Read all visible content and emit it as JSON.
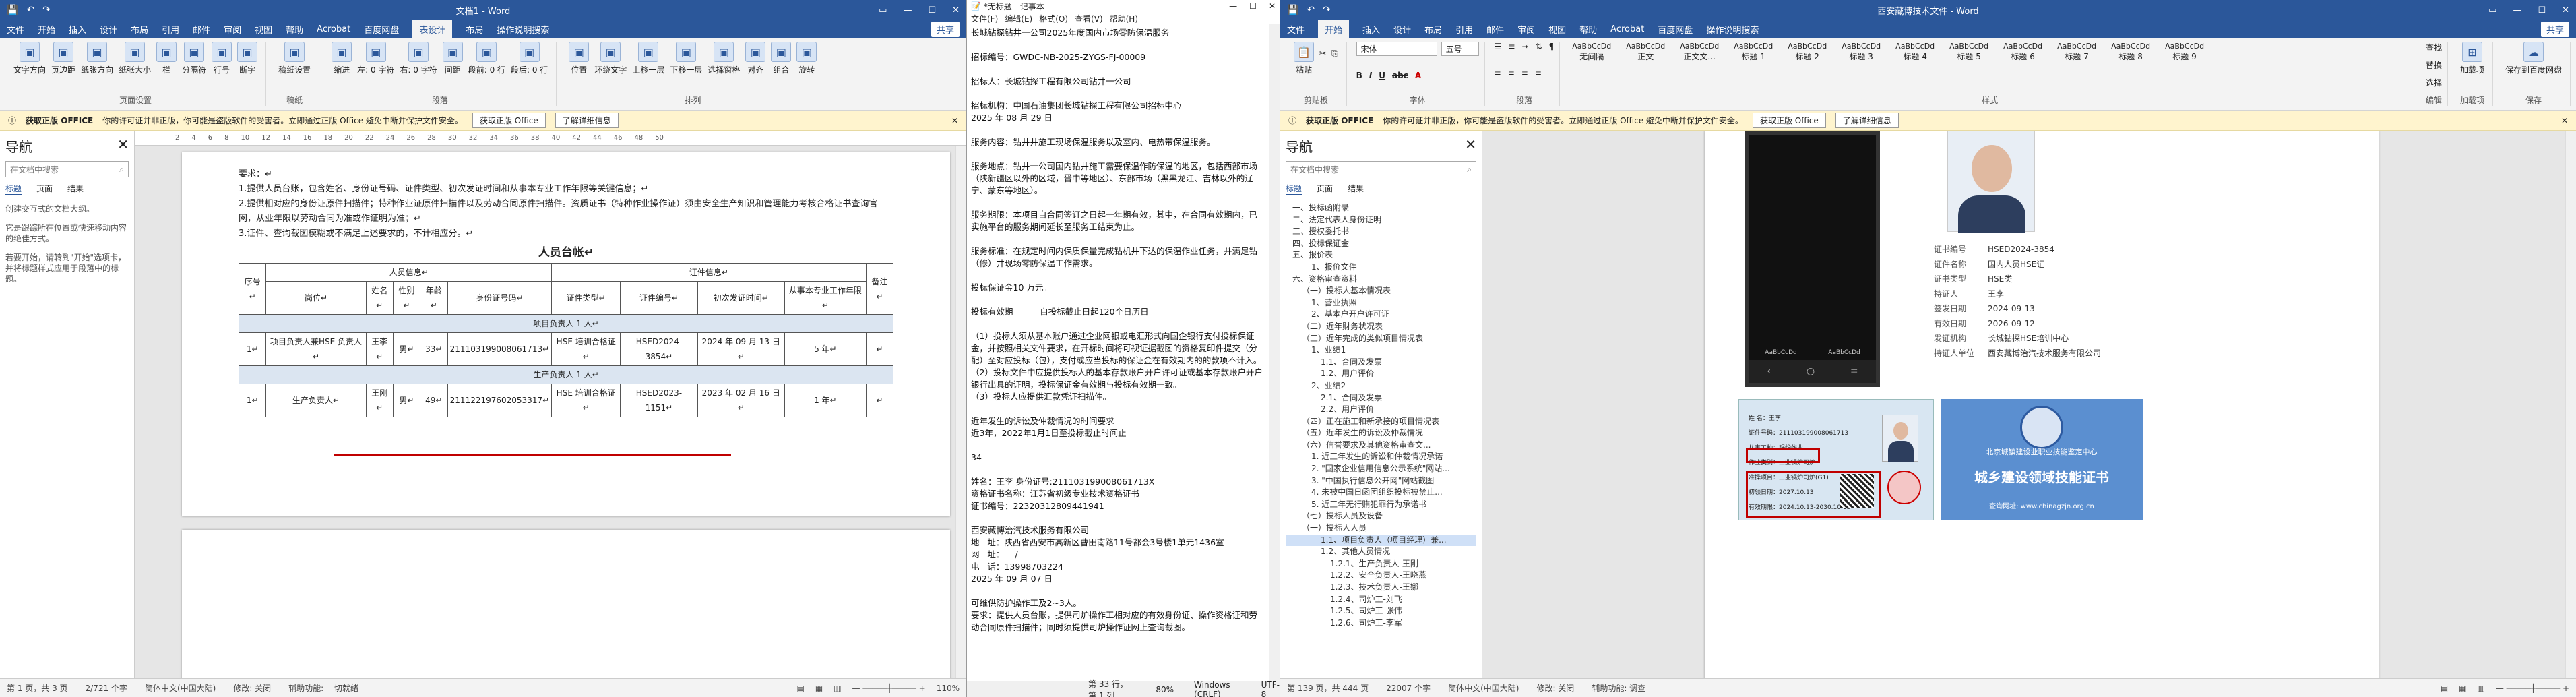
{
  "w1": {
    "title": "文档1 - Word",
    "context_tab": "表格工具",
    "tabs": [
      "文件",
      "开始",
      "插入",
      "设计",
      "布局",
      "引用",
      "邮件",
      "审阅",
      "视图",
      "帮助",
      "Acrobat",
      "百度网盘",
      "表设计",
      "布局"
    ],
    "active_tab": "布局",
    "search_hint": "操作说明搜索",
    "share": "共享",
    "ribbon": {
      "groups": [
        {
          "label": "页面设置",
          "buttons": [
            "文字方向",
            "页边距",
            "纸张方向",
            "纸张大小",
            "栏",
            "分隔符",
            "行号",
            "断字"
          ]
        },
        {
          "label": "稿纸",
          "buttons": [
            "稿纸设置"
          ]
        },
        {
          "label": "段落",
          "buttons": [
            "缩进",
            "左: 0 字符",
            "右: 0 字符",
            "间距",
            "段前: 0 行",
            "段后: 0 行"
          ]
        },
        {
          "label": "排列",
          "buttons": [
            "位置",
            "环绕文字",
            "上移一层",
            "下移一层",
            "选择窗格",
            "对齐",
            "组合",
            "旋转"
          ]
        }
      ]
    },
    "msg": {
      "label": "获取正版 OFFICE",
      "text": "你的许可证并非正版，你可能是盗版软件的受害者。立即通过正版 Office 避免中断并保护文件安全。",
      "btn1": "获取正版 Office",
      "btn2": "了解详细信息"
    },
    "nav": {
      "title": "导航",
      "search": "在文档中搜索",
      "tabs": [
        "标题",
        "页面",
        "结果"
      ],
      "p1": "创建交互式的文档大纲。",
      "p2": "它是跟踪所在位置或快速移动内容的绝佳方式。",
      "p3": "若要开始，请转到\"开始\"选项卡，并将标题样式应用于段落中的标题。"
    },
    "doc": {
      "line0": "要求：↵",
      "line1": "1.提供人员台账，包含姓名、身份证号码、证件类型、初次发证时间和从事本专业工作年限等关键信息；↵",
      "line2": "2.提供相对应的身份证原件扫描件；特种作业证原件扫描件以及劳动合同原件扫描件。资质证书（特种作业操作证）须由安全生产知识和管理能力考核合格证书查询官网，从业年限以劳动合同为准或作证明为准；↵",
      "line3": "3.证件、查询截图模糊或不满足上述要求的，不计相应分。↵",
      "table_title": "人员台帐↵",
      "headers": {
        "seq": "序号↵",
        "personnel": "人员信息↵",
        "cert": "证件信息↵",
        "remark": "备注↵",
        "post": "岗位↵",
        "name": "姓名↵",
        "gender": "性别↵",
        "age": "年龄↵",
        "idno": "身份证号码↵",
        "ctype": "证件类型↵",
        "cno": "证件编号↵",
        "first": "初次发证时间↵",
        "years": "从事本专业工作年限↵"
      },
      "section1": "项目负责人 1 人↵",
      "row1": [
        "1↵",
        "项目负责人兼HSE 负责人↵",
        "王李↵",
        "男↵",
        "33↵",
        "211103199008061713↵",
        "HSE 培训合格证↵",
        "HSED2024-3854↵",
        "2024 年 09 月 13 日↵",
        "5 年↵",
        "↵"
      ],
      "section2": "生产负责人 1 人↵",
      "row2": [
        "1↵",
        "生产负责人↵",
        "王刚↵",
        "男↵",
        "49↵",
        "211122197602053317↵",
        "HSE 培训合格证↵",
        "HSED2023-1151↵",
        "2023 年 02 月 16 日↵",
        "1 年↵",
        "↵"
      ]
    },
    "status": {
      "page": "第 1 页，共 3 页",
      "words": "2/721 个字",
      "lang": "简体中文(中国大陆)",
      "mode": "修改: 关闭",
      "access": "辅助功能: 一切就绪",
      "zoom": "110%"
    }
  },
  "w2": {
    "title": "*无标题 - 记事本",
    "menu": [
      "文件(F)",
      "编辑(E)",
      "格式(O)",
      "查看(V)",
      "帮助(H)"
    ],
    "text": "长城钻探钻井一公司2025年度国内市场零防保温服务\n\n招标编号：GWDC-NB-2025-ZYGS-FJ-00009\n\n招标人：长城钻探工程有限公司钻井一公司\n\n招标机构：中国石油集团长城钻探工程有限公司招标中心\n2025 年 08 月 29 日\n\n服务内容：钻井井施工现场保温服务以及室内、电热带保温服务。\n\n服务地点：钻井一公司国内钻井施工需要保温作防保温的地区，包括西部市场（陕新疆区以外的区域，晋中等地区）、东部市场（黑黑龙江、吉林以外的辽宁、蒙东等地区）。\n\n服务期限：本项目自合同签订之日起一年期有效，其中，在合同有效期内，已实施平台的服务期间延长至服务工结束为止。\n\n服务标准：在规定时间内保质保量完成钻机井下达的保温作业任务，并满足钻（修）井现场零防保温工作需求。\n\n投标保证金10 万元。\n\n投标有效期          自投标截止日起120个日历日\n\n（1）投标人须从基本账户通过企业网银或电汇形式向国企银行支付投标保证金，并按照相关文件要求，在开标时间将可视证据截图的资格复印件提交（分配）至对应投标（包），支付或应当投标的保证金在有效期内的的款项不计入。\n（2）投标文件中应提供投标人的基本存款账户开户许可证或基本存款账户开户银行出具的证明，投标保证金有效期与投标有效期一致。\n（3）投标人应提供汇款凭证扫描件。\n\n近年发生的诉讼及仲裁情况的时间要求\n近3年，2022年1月1日至投标截止时间止\n\n34\n\n姓名：王李 身份证号:211103199008061713X\n资格证书名称：江苏省初级专业技术资格证书\n证书编号：22320312809441941\n\n西安藏博治汽技术服务有限公司\n地   址：陕西省西安市高新区曹田南路11号都会3号楼1单元1436室\n网   址：    /\n电   话：13998703224\n2025 年 09 月 07 日\n\n可维供防护操作工及2~3人。\n要求：提供人员台账，提供司炉操作工相对应的有效身份证、操作资格证和劳动合同原件扫描件；同时须提供司炉操作证网上查询截图。",
    "status": {
      "pos": "第 33 行，第 1 列",
      "zoom": "80%",
      "eol": "Windows (CRLF)",
      "enc": "UTF-8"
    }
  },
  "w3": {
    "title": "西安藏博技术文件 - Word",
    "tabs": [
      "文件",
      "开始",
      "插入",
      "设计",
      "布局",
      "引用",
      "邮件",
      "审阅",
      "视图",
      "帮助",
      "Acrobat",
      "百度网盘"
    ],
    "active_tab": "开始",
    "search_hint": "操作说明搜索",
    "share": "共享",
    "ribbon": {
      "font": "宋体",
      "size": "五号",
      "styles": [
        "无间隔",
        "正文",
        "正文文...",
        "标题 1",
        "标题 2",
        "标题 3",
        "标题 4",
        "标题 5",
        "标题 6",
        "标题 7",
        "标题 8",
        "标题 9"
      ],
      "groups": [
        "剪贴板",
        "字体",
        "段落",
        "样式",
        "编辑",
        "加载项",
        "保存"
      ],
      "edit": [
        "查找",
        "替换",
        "选择"
      ],
      "save": "保存到百度网盘",
      "addins": "加载项"
    },
    "msg": {
      "label": "获取正版 OFFICE",
      "text": "你的许可证并非正版，你可能是盗版软件的受害者。立即通过正版 Office 避免中断并保护文件安全。",
      "btn1": "获取正版 Office",
      "btn2": "了解详细信息"
    },
    "nav": {
      "title": "导航",
      "search": "在文档中搜索",
      "tabs": [
        "标题",
        "页面",
        "结果"
      ],
      "items": [
        "一、投标函附录",
        "二、法定代表人身份证明",
        "三、授权委托书",
        "四、投标保证金",
        "五、报价表",
        "1、报价文件",
        "六、资格审查资料",
        "（一）投标人基本情况表",
        "1、营业执照",
        "2、基本户开户许可证",
        "（二）近年财务状况表",
        "（三）近年完成的类似项目情况表",
        "1、业绩1",
        "1.1、合同及发票",
        "1.2、用户评价",
        "2、业绩2",
        "2.1、合同及发票",
        "2.2、用户评价",
        "（四）正在施工和新承接的项目情况表",
        "（五）近年发生的诉讼及仲裁情况",
        "（六）信誉要求及其他资格审查文...",
        "1. 近三年发生的诉讼和仲裁情况承诺",
        "2. \"国家企业信用信息公示系统\"网站...",
        "3. \"中国执行信息公开网\"网站截图",
        "4. 未被中国日函团组织投标被禁止...",
        "5. 近三年无行贿犯罪行为承诺书",
        "（七）投标人员及设备",
        "（一）投标人人员",
        "1.1、项目负责人（项目经理）兼...",
        "1.2、其他人员情况",
        "1.2.1、生产负责人-王刚",
        "1.2.2、安全负责人-王晓燕",
        "1.2.3、技术负责人-王娜",
        "1.2.4、司炉工-刘飞",
        "1.2.5、司炉工-张伟",
        "1.2.6、司炉工-李军"
      ],
      "selected": 28
    },
    "cert": {
      "rows": [
        [
          "证书编号",
          "HSED2024-3854"
        ],
        [
          "证件名称",
          "国内人员HSE证"
        ],
        [
          "证书类型",
          "HSE类"
        ],
        [
          "持证人",
          "王李"
        ],
        [
          "签发日期",
          "2024-09-13"
        ],
        [
          "有效日期",
          "2026-09-12"
        ],
        [
          "发证机构",
          "长城钻探HSE培训中心"
        ],
        [
          "持证人单位",
          "西安藏博治汽技术服务有限公司"
        ]
      ],
      "card1": [
        "姓 名：王李",
        "证件号码：211103199008061713",
        "从事工种：锅炉作业",
        "作业类别：工业锅炉司炉",
        "准操项目：工业锅炉司炉(G1)",
        "初领日期：2027.10.13",
        "有效期限：2024.10.13-2030.10.13"
      ],
      "card2_small": "北京城镇建设业职业技能鉴定中心",
      "card2_big": "城乡建设领域技能证书",
      "card2_url": "查询网址: www.chinagzjn.org.cn",
      "phone_apps": [
        "AaBbCcDd",
        "AaBbCcDd"
      ]
    },
    "status": {
      "page": "第 139 页，共 444 页",
      "words": "22007 个字",
      "lang": "简体中文(中国大陆)",
      "mode": "修改: 关闭",
      "access": "辅助功能: 调查"
    }
  }
}
